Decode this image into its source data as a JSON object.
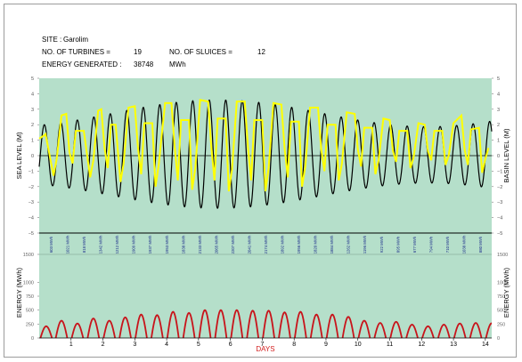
{
  "header": {
    "site_label": "SITE :",
    "site_value": "Garolim",
    "turbines_label": "NO. OF TURBINES =",
    "turbines_value": "19",
    "sluices_label": "NO. OF SLUICES =",
    "sluices_value": "12",
    "energy_label": "ENERGY GENERATED :",
    "energy_value": "38748",
    "energy_unit": "MWh"
  },
  "chart_data": [
    {
      "type": "line",
      "ylabel_left": "SEA LEVEL (M)",
      "ylabel_right": "BASIN LEVEL (M)",
      "ylim": [
        -5,
        5
      ],
      "yticks": [
        "5",
        "4",
        "3",
        "2",
        "1",
        "0",
        "−1",
        "−2",
        "−3",
        "−4",
        "−5"
      ],
      "background": "#b5dfca",
      "series": [
        {
          "color": "#000000",
          "tide": {
            "period_days": 0.5175,
            "peak_amplitude": 3.6,
            "trough_amplitude": 3.4,
            "min_range_fraction": 0.52,
            "springs_day": 5.6,
            "neaps_day": 12.2
          }
        },
        {
          "color": "#ffff00",
          "points": [
            [
              0,
              1.1
            ],
            [
              0.15,
              1.3
            ],
            [
              0.2,
              1.4
            ],
            [
              0.45,
              -1.3
            ],
            [
              0.55,
              -0.2
            ],
            [
              0.7,
              2.6
            ],
            [
              0.85,
              2.7
            ],
            [
              0.95,
              0.2
            ],
            [
              1.05,
              -0.5
            ],
            [
              1.15,
              1.6
            ],
            [
              1.4,
              1.6
            ],
            [
              1.6,
              -1.4
            ],
            [
              1.7,
              -0.3
            ],
            [
              1.85,
              2.9
            ],
            [
              1.95,
              3.0
            ],
            [
              2.05,
              0.5
            ],
            [
              2.15,
              -0.8
            ],
            [
              2.25,
              2.0
            ],
            [
              2.4,
              2.0
            ],
            [
              2.55,
              -1.7
            ],
            [
              2.65,
              -0.5
            ],
            [
              2.8,
              3.1
            ],
            [
              3.0,
              3.2
            ],
            [
              3.1,
              0.5
            ],
            [
              3.2,
              -1.2
            ],
            [
              3.3,
              2.1
            ],
            [
              3.55,
              2.1
            ],
            [
              3.65,
              -2.0
            ],
            [
              3.75,
              -0.6
            ],
            [
              3.95,
              3.4
            ],
            [
              4.15,
              3.4
            ],
            [
              4.25,
              0.6
            ],
            [
              4.35,
              -1.6
            ],
            [
              4.45,
              2.3
            ],
            [
              4.7,
              2.3
            ],
            [
              4.8,
              -2.2
            ],
            [
              4.9,
              -0.8
            ],
            [
              5.05,
              3.6
            ],
            [
              5.3,
              3.5
            ],
            [
              5.4,
              0.6
            ],
            [
              5.5,
              -1.6
            ],
            [
              5.6,
              2.4
            ],
            [
              5.85,
              2.4
            ],
            [
              5.95,
              -2.3
            ],
            [
              6.05,
              -0.9
            ],
            [
              6.2,
              3.5
            ],
            [
              6.45,
              3.5
            ],
            [
              6.55,
              0.6
            ],
            [
              6.65,
              -1.6
            ],
            [
              6.75,
              2.3
            ],
            [
              7.0,
              2.3
            ],
            [
              7.1,
              -2.3
            ],
            [
              7.2,
              -0.8
            ],
            [
              7.35,
              3.4
            ],
            [
              7.6,
              3.3
            ],
            [
              7.7,
              0.5
            ],
            [
              7.8,
              -1.4
            ],
            [
              7.9,
              2.2
            ],
            [
              8.15,
              2.2
            ],
            [
              8.25,
              -2.0
            ],
            [
              8.35,
              -0.7
            ],
            [
              8.5,
              3.1
            ],
            [
              8.75,
              3.1
            ],
            [
              8.85,
              0.4
            ],
            [
              8.95,
              -1.0
            ],
            [
              9.05,
              2.0
            ],
            [
              9.3,
              2.0
            ],
            [
              9.4,
              -1.6
            ],
            [
              9.5,
              -0.5
            ],
            [
              9.65,
              2.8
            ],
            [
              9.9,
              2.7
            ],
            [
              10.0,
              0.4
            ],
            [
              10.1,
              -0.7
            ],
            [
              10.2,
              1.8
            ],
            [
              10.45,
              1.8
            ],
            [
              10.55,
              -1.2
            ],
            [
              10.65,
              -0.3
            ],
            [
              10.8,
              2.4
            ],
            [
              11.0,
              2.3
            ],
            [
              11.1,
              0.3
            ],
            [
              11.2,
              -0.4
            ],
            [
              11.3,
              1.6
            ],
            [
              11.55,
              1.6
            ],
            [
              11.65,
              -0.8
            ],
            [
              11.75,
              -0.1
            ],
            [
              11.9,
              2.1
            ],
            [
              12.1,
              2.0
            ],
            [
              12.2,
              0.3
            ],
            [
              12.3,
              -0.3
            ],
            [
              12.4,
              1.6
            ],
            [
              12.65,
              1.6
            ],
            [
              12.75,
              -0.6
            ],
            [
              12.85,
              0.0
            ],
            [
              13.0,
              2.1
            ],
            [
              13.25,
              2.6
            ],
            [
              13.35,
              0.4
            ],
            [
              13.45,
              -0.6
            ],
            [
              13.55,
              1.7
            ],
            [
              13.8,
              1.8
            ],
            [
              13.9,
              -1.1
            ],
            [
              14.0,
              -0.2
            ],
            [
              14.1,
              0.5
            ]
          ]
        }
      ]
    },
    {
      "type": "table",
      "caption_unit": "MWh",
      "values": [
        "603",
        "1021",
        "818",
        "1342",
        "1212",
        "1909",
        "1937",
        "1953",
        "1838",
        "2133",
        "2065",
        "2207",
        "2041",
        "2174",
        "1892",
        "1956",
        "1820",
        "1884",
        "1262",
        "1196",
        "922",
        "895",
        "677",
        "794",
        "710",
        "1038",
        "880"
      ]
    },
    {
      "type": "area",
      "ylabel_left": "ENERGY (MWh)",
      "ylabel_right": "ENERGY (MWh)",
      "xlabel": "DAYS",
      "ylim": [
        0,
        1500
      ],
      "yticks": [
        "1500",
        "1000",
        "750",
        "500",
        "250",
        "0"
      ],
      "xlim": [
        0,
        14.2
      ],
      "xticks": [
        "1",
        "2",
        "3",
        "4",
        "5",
        "6",
        "7",
        "8",
        "9",
        "10",
        "11",
        "12",
        "13",
        "14"
      ],
      "background": "#b5dfca",
      "pulse_width_days": 0.36,
      "pulses": [
        [
          0.22,
          210
        ],
        [
          0.7,
          310
        ],
        [
          1.2,
          260
        ],
        [
          1.7,
          350
        ],
        [
          2.2,
          310
        ],
        [
          2.7,
          370
        ],
        [
          3.2,
          420
        ],
        [
          3.7,
          410
        ],
        [
          4.2,
          470
        ],
        [
          4.7,
          450
        ],
        [
          5.2,
          500
        ],
        [
          5.7,
          500
        ],
        [
          6.2,
          500
        ],
        [
          6.7,
          490
        ],
        [
          7.2,
          490
        ],
        [
          7.7,
          460
        ],
        [
          8.2,
          470
        ],
        [
          8.7,
          420
        ],
        [
          9.2,
          420
        ],
        [
          9.7,
          380
        ],
        [
          10.2,
          310
        ],
        [
          10.7,
          270
        ],
        [
          11.2,
          290
        ],
        [
          11.7,
          240
        ],
        [
          12.2,
          210
        ],
        [
          12.7,
          240
        ],
        [
          13.2,
          260
        ],
        [
          13.7,
          270
        ],
        [
          14.2,
          265
        ]
      ]
    }
  ]
}
